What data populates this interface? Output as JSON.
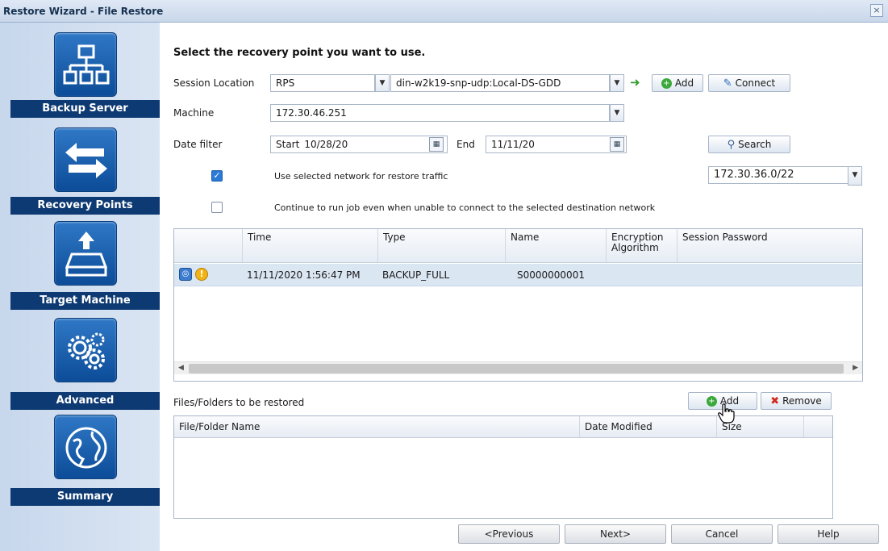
{
  "window": {
    "title": "Restore Wizard - File Restore",
    "close": "×"
  },
  "sidebar": {
    "steps": [
      {
        "label": "Backup Server",
        "icon": "backup-server-icon"
      },
      {
        "label": "Recovery Points",
        "icon": "recovery-points-icon"
      },
      {
        "label": "Target Machine",
        "icon": "target-machine-icon"
      },
      {
        "label": "Advanced",
        "icon": "advanced-gears-icon"
      },
      {
        "label": "Summary",
        "icon": "summary-globe-icon"
      }
    ]
  },
  "form": {
    "heading": "Select the recovery point you want to use.",
    "session_location": {
      "label": "Session Location",
      "type_value": "RPS",
      "server_value": "din-w2k19-snp-udp:Local-DS-GDD",
      "add_label": "Add",
      "connect_label": "Connect"
    },
    "machine": {
      "label": "Machine",
      "value": "172.30.46.251"
    },
    "date_filter": {
      "label": "Date filter",
      "start_label": "Start",
      "start_value": "10/28/20",
      "end_label": "End",
      "end_value": "11/11/20",
      "search_label": "Search"
    },
    "network": {
      "use_selected_label": "Use selected network for restore traffic",
      "use_selected_checked": true,
      "network_value": "172.30.36.0/22",
      "continue_label": "Continue to run job even when unable to connect to the selected destination network",
      "continue_checked": false
    }
  },
  "recovery_points": {
    "columns": [
      "Time",
      "Type",
      "Name",
      "Encryption Algorithm",
      "Session Password"
    ],
    "rows": [
      {
        "time": "11/11/2020 1:56:47 PM",
        "type": "BACKUP_FULL",
        "name": "S0000000001",
        "encryption": "",
        "password": ""
      }
    ]
  },
  "files": {
    "label": "Files/Folders to be restored",
    "add_label": "Add",
    "remove_label": "Remove",
    "columns": [
      "File/Folder Name",
      "Date Modified",
      "Size"
    ]
  },
  "footer": {
    "previous": "<Previous",
    "next": "Next>",
    "cancel": "Cancel",
    "help": "Help"
  },
  "colors": {
    "sidebar_label_bg": "#0e3a73",
    "tile_blue": "#1c5fae",
    "selected_row": "#dbe6f3"
  }
}
